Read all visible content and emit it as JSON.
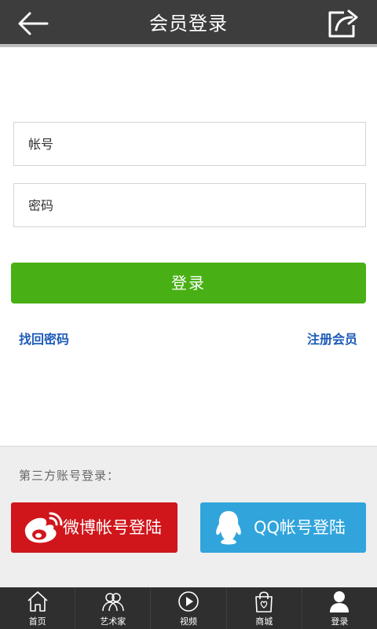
{
  "header": {
    "title": "会员登录"
  },
  "form": {
    "account_placeholder": "帐号",
    "password_placeholder": "密码",
    "login_label": "登录",
    "forgot_label": "找回密码",
    "register_label": "注册会员"
  },
  "third_party": {
    "label": "第三方账号登录：",
    "weibo_label": "微博帐号登陆",
    "qq_label": "QQ帐号登陆"
  },
  "tabbar": {
    "items": [
      {
        "label": "首页",
        "icon": "home-icon"
      },
      {
        "label": "艺术家",
        "icon": "artists-icon"
      },
      {
        "label": "视频",
        "icon": "play-icon"
      },
      {
        "label": "商城",
        "icon": "shopping-bag-icon"
      },
      {
        "label": "登录",
        "icon": "user-icon"
      }
    ]
  },
  "colors": {
    "header_bg": "#3d3d3d",
    "login_button": "#48b014",
    "link": "#1e5bb8",
    "weibo": "#d0151b",
    "qq": "#31a4dc",
    "tabbar_bg": "#2f2f2f"
  }
}
